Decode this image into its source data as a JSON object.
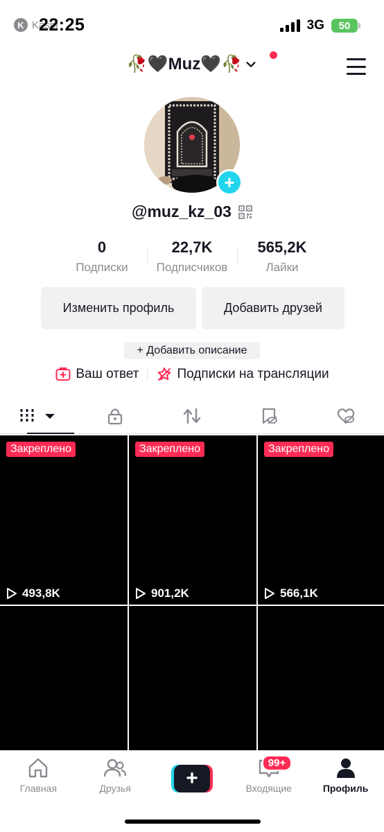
{
  "status_bar": {
    "back_label": "Kaspi",
    "time": "22:25",
    "network": "3G",
    "battery": "50"
  },
  "header": {
    "account_name": "🥀🖤Muz🖤🥀"
  },
  "profile": {
    "username": "@muz_kz_03",
    "stats": [
      {
        "value": "0",
        "label": "Подписки"
      },
      {
        "value": "22,7K",
        "label": "Подписчиков"
      },
      {
        "value": "565,2K",
        "label": "Лайки"
      }
    ],
    "edit_profile_label": "Изменить профиль",
    "add_friends_label": "Добавить друзей",
    "add_bio_label": "+ Добавить описание",
    "your_answer_label": "Ваш ответ",
    "live_subscriptions_label": "Подписки на трансляции"
  },
  "videos": [
    {
      "pinned_label": "Закреплено",
      "views": "493,8K"
    },
    {
      "pinned_label": "Закреплено",
      "views": "901,2K"
    },
    {
      "pinned_label": "Закреплено",
      "views": "566,1K"
    },
    {},
    {},
    {}
  ],
  "bottom_nav": {
    "home_label": "Главная",
    "friends_label": "Друзья",
    "inbox_label": "Входящие",
    "inbox_badge": "99+",
    "profile_label": "Профиль"
  },
  "colors": {
    "accent": "#fe2c55",
    "cyan": "#20d5ec",
    "text": "#161823",
    "muted": "#8a8b91"
  }
}
